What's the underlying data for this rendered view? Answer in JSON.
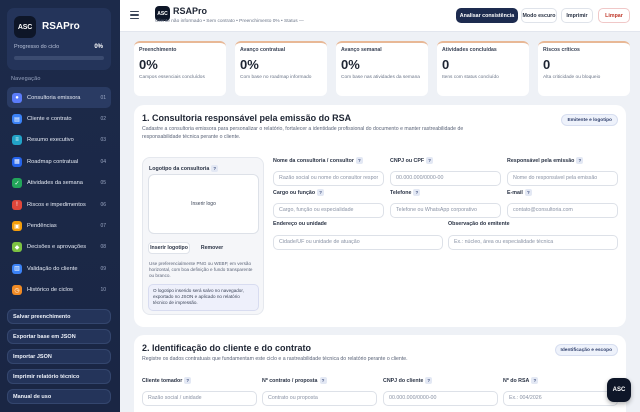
{
  "app": {
    "name": "RSAPro",
    "logo_text": "ASC",
    "progress_label": "Progresso do ciclo",
    "progress_value": "0%",
    "progress_fraction": 0
  },
  "sidebar": {
    "nav_title": "Navegação",
    "items": [
      {
        "label": "Consultoria emissora",
        "num": "01",
        "color": "#5b7cfa",
        "icon": "users-icon",
        "glyph": "●"
      },
      {
        "label": "Cliente e contrato",
        "num": "02",
        "color": "#3b82f6",
        "icon": "document-icon",
        "glyph": "▤"
      },
      {
        "label": "Resumo executivo",
        "num": "03",
        "color": "#22a3c7",
        "icon": "summary-icon",
        "glyph": "≡"
      },
      {
        "label": "Roadmap contratual",
        "num": "04",
        "color": "#2563eb",
        "icon": "roadmap-icon",
        "glyph": "▦"
      },
      {
        "label": "Atividades da semana",
        "num": "05",
        "color": "#22a55a",
        "icon": "check-icon",
        "glyph": "✓"
      },
      {
        "label": "Riscos e impedimentos",
        "num": "06",
        "color": "#e0463a",
        "icon": "warning-icon",
        "glyph": "!"
      },
      {
        "label": "Pendências",
        "num": "07",
        "color": "#f59e0b",
        "icon": "clipboard-icon",
        "glyph": "▣"
      },
      {
        "label": "Decisões e aprovações",
        "num": "08",
        "color": "#7cc242",
        "icon": "thumbs-up-icon",
        "glyph": "◆"
      },
      {
        "label": "Validação do cliente",
        "num": "09",
        "color": "#3b82f6",
        "icon": "chart-icon",
        "glyph": "▥"
      },
      {
        "label": "Histórico de ciclos",
        "num": "10",
        "color": "#f08a24",
        "icon": "history-icon",
        "glyph": "◷"
      }
    ],
    "buttons": [
      "Salvar preenchimento",
      "Exportar base em JSON",
      "Importar JSON",
      "Imprimir relatório técnico",
      "Manual de uso"
    ]
  },
  "topbar": {
    "logo_text": "ASC",
    "title": "RSAPro",
    "subtitle": "Cliente não informado • Sem contrato • Preenchimento 0% • Status —",
    "buttons": {
      "analyze": "Analisar consistência",
      "dark_mode": "Modo escuro",
      "print": "Imprimir",
      "clear": "Limpar"
    }
  },
  "stats": [
    {
      "label": "Preenchimento",
      "value": "0%",
      "desc": "Campos essenciais concluídos"
    },
    {
      "label": "Avanço contratual",
      "value": "0%",
      "desc": "Com base no roadmap informado"
    },
    {
      "label": "Avanço semanal",
      "value": "0%",
      "desc": "Com base nas atividades da semana"
    },
    {
      "label": "Atividades concluídas",
      "value": "0",
      "desc": "Itens com status concluído"
    },
    {
      "label": "Riscos críticos",
      "value": "0",
      "desc": "Alta criticidade ou bloqueio"
    }
  ],
  "section1": {
    "title": "1. Consultoria responsável pela emissão do RSA",
    "desc": "Cadastre a consultoria emissora para personalizar o relatório, fortalecer a identidade profissional do documento e manter rastreabilidade de responsabilidade técnica perante o cliente.",
    "badge": "Emitente e logotipo",
    "logo": {
      "title": "Logotipo da consultoria",
      "drop_label": "Inserir logo",
      "insert_button": "Inserir logotipo",
      "remove_button": "Remover",
      "note": "Use preferencialmente PNG ou WEBP, em versão horizontal, com boa definição e fundo transparente ou branco.",
      "info": "O logotipo inserido será salvo no navegador, exportado no JSON e aplicado no relatório técnico de impressão."
    },
    "fields": {
      "company_name": {
        "label": "Nome da consultoria / consultor",
        "placeholder": "Razão social ou nome do consultor responsável"
      },
      "cnpj_cpf": {
        "label": "CNPJ ou CPF",
        "placeholder": "00.000.000/0000-00"
      },
      "responsible": {
        "label": "Responsável pela emissão",
        "placeholder": "Nome do responsável pela emissão"
      },
      "role": {
        "label": "Cargo ou função",
        "placeholder": "Cargo, função ou especialidade"
      },
      "phone": {
        "label": "Telefone",
        "placeholder": "Telefone ou WhatsApp corporativo"
      },
      "email": {
        "label": "E-mail",
        "placeholder": "contato@consultoria.com"
      },
      "address": {
        "label": "Endereço ou unidade",
        "placeholder": "Cidade/UF ou unidade de atuação"
      },
      "note": {
        "label": "Observação do emitente",
        "placeholder": "Ex.: núcleo, área ou especialidade técnica"
      }
    }
  },
  "section2": {
    "title": "2. Identificação do cliente e do contrato",
    "desc": "Registre os dados contratuais que fundamentam este ciclo e a rastreabilidade técnica do relatório perante o cliente.",
    "badge": "Identificação e escopo",
    "fields": {
      "client": {
        "label": "Cliente tomador",
        "placeholder": "Razão social / unidade"
      },
      "contract": {
        "label": "Nº contrato / proposta",
        "placeholder": "Contrato ou proposta"
      },
      "cnpj": {
        "label": "CNPJ do cliente",
        "placeholder": "00.000.000/0000-00"
      },
      "rsa": {
        "label": "Nº do RSA",
        "placeholder": "Ex.: 004/2026"
      }
    }
  },
  "fab": {
    "text": "ASC"
  }
}
